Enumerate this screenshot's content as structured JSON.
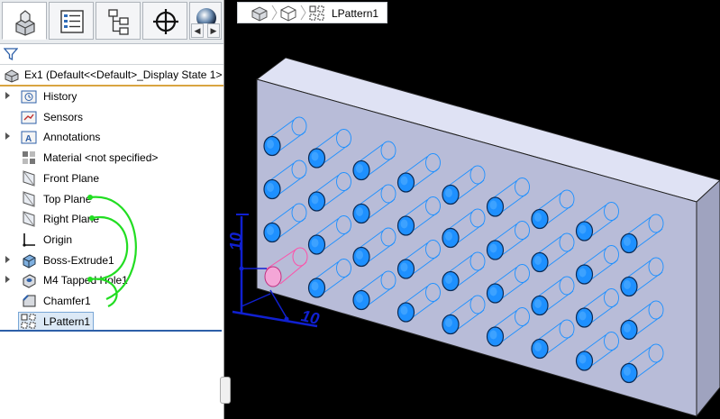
{
  "feature_manager": {
    "tabs": [
      {
        "name": "feature-manager-tab",
        "icon": "part-tree-icon"
      },
      {
        "name": "property-manager-tab",
        "icon": "property-list-icon"
      },
      {
        "name": "configuration-manager-tab",
        "icon": "configuration-tree-icon"
      },
      {
        "name": "dimxpert-tab",
        "icon": "crosshair-icon"
      },
      {
        "name": "display-manager-tab",
        "icon": "appearance-sphere-icon"
      }
    ],
    "filter_icon": "funnel-icon",
    "root_label": "Ex1  (Default<<Default>_Display State 1>",
    "items": [
      {
        "label": "History",
        "icon": "history-folder-icon",
        "expandable": true
      },
      {
        "label": "Sensors",
        "icon": "sensors-folder-icon",
        "expandable": false
      },
      {
        "label": "Annotations",
        "icon": "annotations-folder-icon",
        "expandable": true
      },
      {
        "label": "Material <not specified>",
        "icon": "material-icon",
        "expandable": false
      },
      {
        "label": "Front Plane",
        "icon": "plane-icon",
        "expandable": false
      },
      {
        "label": "Top Plane",
        "icon": "plane-icon",
        "expandable": false
      },
      {
        "label": "Right Plane",
        "icon": "plane-icon",
        "expandable": false
      },
      {
        "label": "Origin",
        "icon": "origin-icon",
        "expandable": false
      },
      {
        "label": "Boss-Extrude1",
        "icon": "extrude-icon",
        "expandable": true
      },
      {
        "label": "M4 Tapped Hole1",
        "icon": "hole-wizard-icon",
        "expandable": true
      },
      {
        "label": "Chamfer1",
        "icon": "chamfer-icon",
        "expandable": false
      },
      {
        "label": "LPattern1",
        "icon": "linear-pattern-icon",
        "expandable": false,
        "selected": true
      }
    ]
  },
  "breadcrumb": {
    "icons": [
      "part-icon",
      "body-icon",
      "linear-pattern-icon"
    ],
    "label": "LPattern1"
  },
  "viewport": {
    "dimension_labels": [
      "10",
      "10"
    ],
    "colors": {
      "hole": "#1e90ff",
      "seed": "#f4a6d7",
      "block": "#b8bcd8",
      "edge": "#202020",
      "relation": "#22dd22"
    }
  }
}
